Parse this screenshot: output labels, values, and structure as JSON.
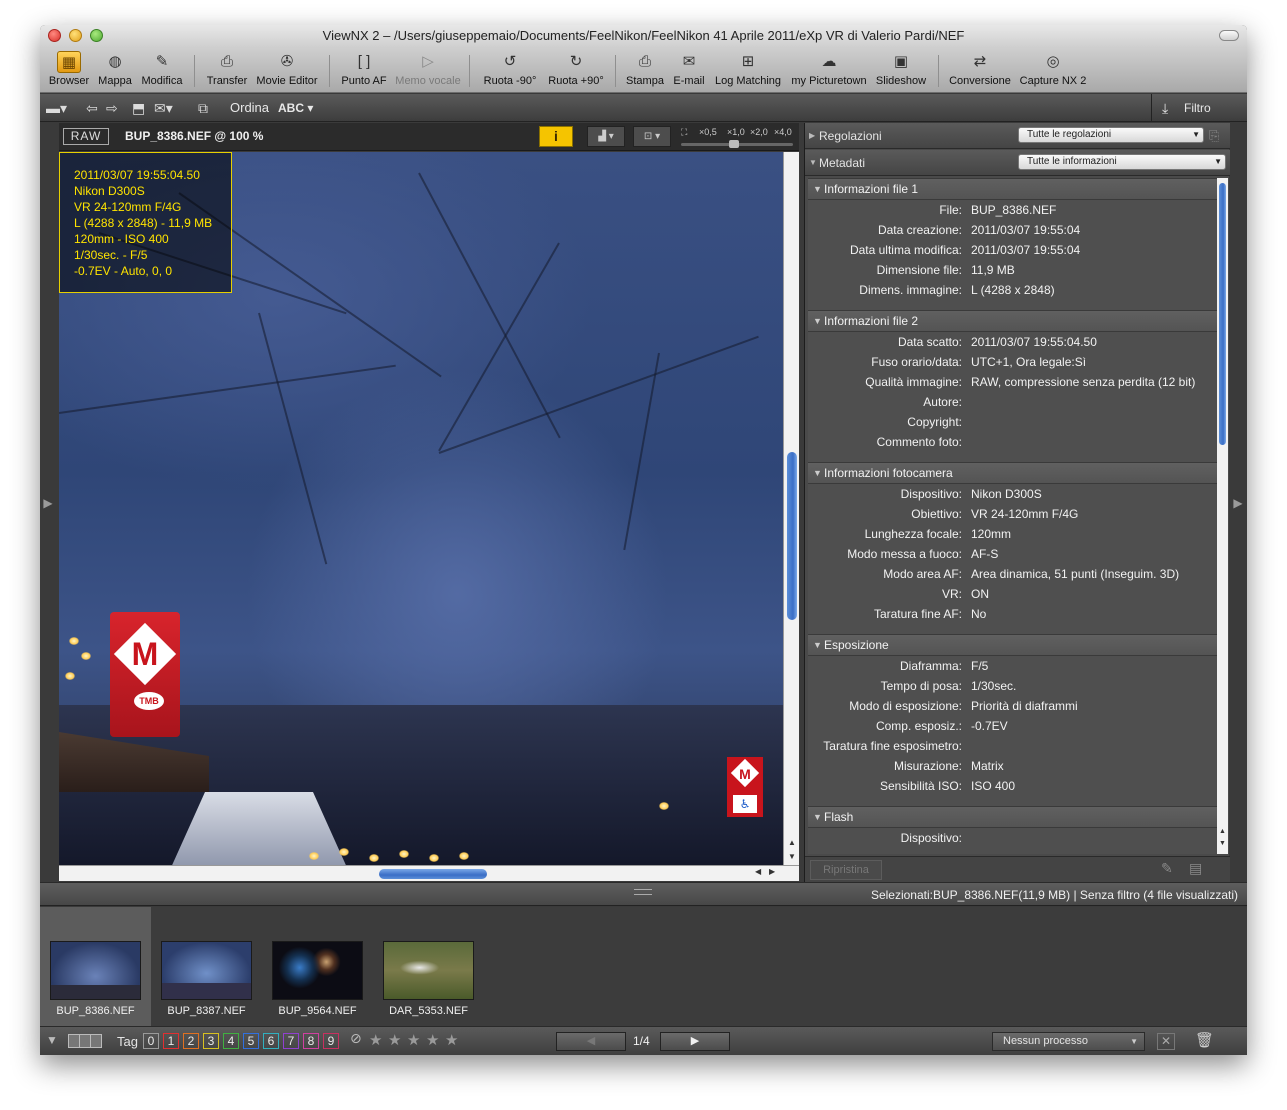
{
  "window": {
    "title": "ViewNX 2 – /Users/giuseppemaio/Documents/FeelNikon/FeelNikon 41 Aprile 2011/eXp VR di Valerio Pardi/NEF"
  },
  "toolbar": {
    "items": [
      {
        "label": "Browser",
        "icon": "browser-icon"
      },
      {
        "label": "Mappa",
        "icon": "map-globe-icon"
      },
      {
        "label": "Modifica",
        "icon": "edit-pencil-icon"
      },
      {
        "label": "Transfer",
        "icon": "camera-transfer-icon"
      },
      {
        "label": "Movie Editor",
        "icon": "film-reel-icon"
      },
      {
        "label": "Punto AF",
        "icon": "af-point-icon"
      },
      {
        "label": "Memo vocale",
        "icon": "voice-memo-icon"
      },
      {
        "label": "Ruota -90°",
        "icon": "rotate-left-icon"
      },
      {
        "label": "Ruota +90°",
        "icon": "rotate-right-icon"
      },
      {
        "label": "Stampa",
        "icon": "printer-icon"
      },
      {
        "label": "E-mail",
        "icon": "envelope-icon"
      },
      {
        "label": "Log Matching",
        "icon": "log-matching-icon"
      },
      {
        "label": "my Picturetown",
        "icon": "picturetown-icon"
      },
      {
        "label": "Slideshow",
        "icon": "slideshow-icon"
      },
      {
        "label": "Conversione",
        "icon": "conversion-icon"
      },
      {
        "label": "Capture NX 2",
        "icon": "capture-nx-icon"
      }
    ]
  },
  "bar2": {
    "ordina_label": "Ordina",
    "ordina_value": "ABC",
    "filtro_label": "Filtro"
  },
  "viewer": {
    "raw_badge": "RAW",
    "file_label": "BUP_8386.NEF @ 100 %",
    "info_button": "i",
    "zoom_levels": [
      "×0,5",
      "×1,0",
      "×2,0",
      "×4,0"
    ]
  },
  "overlay": {
    "lines": [
      "2011/03/07 19:55:04.50",
      "Nikon D300S",
      "VR 24-120mm F/4G",
      "L (4288 x 2848) - 11,9 MB",
      "120mm - ISO 400",
      "1/30sec. - F/5",
      "-0.7EV - Auto, 0, 0"
    ]
  },
  "photo_signs": {
    "metro_letter": "M",
    "tmb": "TMB"
  },
  "right_panel": {
    "regolazioni": {
      "title": "Regolazioni",
      "select": "Tutte le regolazioni"
    },
    "metadati": {
      "title": "Metadati",
      "select": "Tutte le informazioni"
    },
    "sections": [
      {
        "title": "Informazioni file 1",
        "rows": [
          {
            "k": "File:",
            "v": "BUP_8386.NEF"
          },
          {
            "k": "Data creazione:",
            "v": "2011/03/07 19:55:04"
          },
          {
            "k": "Data ultima modifica:",
            "v": "2011/03/07 19:55:04"
          },
          {
            "k": "Dimensione file:",
            "v": "11,9 MB"
          },
          {
            "k": "Dimens. immagine:",
            "v": "L (4288 x 2848)"
          }
        ]
      },
      {
        "title": "Informazioni file 2",
        "rows": [
          {
            "k": "Data scatto:",
            "v": "2011/03/07 19:55:04.50"
          },
          {
            "k": "Fuso orario/data:",
            "v": "UTC+1, Ora legale:Sì"
          },
          {
            "k": "Qualità immagine:",
            "v": "RAW, compressione senza perdita (12 bit)"
          },
          {
            "k": "Autore:",
            "v": ""
          },
          {
            "k": "Copyright:",
            "v": ""
          },
          {
            "k": "Commento foto:",
            "v": ""
          }
        ]
      },
      {
        "title": "Informazioni fotocamera",
        "rows": [
          {
            "k": "Dispositivo:",
            "v": "Nikon D300S"
          },
          {
            "k": "Obiettivo:",
            "v": "VR 24-120mm F/4G"
          },
          {
            "k": "Lunghezza focale:",
            "v": "120mm"
          },
          {
            "k": "Modo messa a fuoco:",
            "v": "AF-S"
          },
          {
            "k": "Modo area AF:",
            "v": "Area dinamica, 51 punti (Inseguim. 3D)"
          },
          {
            "k": "VR:",
            "v": "ON"
          },
          {
            "k": "Taratura fine AF:",
            "v": "No"
          }
        ]
      },
      {
        "title": "Esposizione",
        "rows": [
          {
            "k": "Diaframma:",
            "v": "F/5"
          },
          {
            "k": "Tempo di posa:",
            "v": "1/30sec."
          },
          {
            "k": "Modo di esposizione:",
            "v": "Priorità di diaframmi"
          },
          {
            "k": "Comp. esposiz.:",
            "v": "-0.7EV"
          },
          {
            "k": "Taratura fine esposimetro:",
            "v": ""
          },
          {
            "k": "Misurazione:",
            "v": "Matrix"
          },
          {
            "k": "Sensibilità ISO:",
            "v": "ISO 400"
          }
        ]
      },
      {
        "title": "Flash",
        "rows": [
          {
            "k": "Dispositivo:",
            "v": ""
          }
        ]
      }
    ],
    "ripristina": "Ripristina"
  },
  "status": {
    "text": "Selezionati:BUP_8386.NEF(11,9 MB) | Senza filtro (4 file visualizzati)"
  },
  "thumbnails": [
    {
      "name": "BUP_8386.NEF",
      "selected": true
    },
    {
      "name": "BUP_8387.NEF",
      "selected": false
    },
    {
      "name": "BUP_9564.NEF",
      "selected": false
    },
    {
      "name": "DAR_5353.NEF",
      "selected": false
    }
  ],
  "bottom": {
    "tag_label": "Tag",
    "tags": [
      {
        "n": "0",
        "color": "#9a9a9a"
      },
      {
        "n": "1",
        "color": "#e03030"
      },
      {
        "n": "2",
        "color": "#e07020"
      },
      {
        "n": "3",
        "color": "#d8c020"
      },
      {
        "n": "4",
        "color": "#40b040"
      },
      {
        "n": "5",
        "color": "#3070e0"
      },
      {
        "n": "6",
        "color": "#30b0c0"
      },
      {
        "n": "7",
        "color": "#9040d0"
      },
      {
        "n": "8",
        "color": "#d040a0"
      },
      {
        "n": "9",
        "color": "#c83060"
      }
    ],
    "rating_stars": 5,
    "page": "1/4",
    "process": "Nessun processo"
  }
}
